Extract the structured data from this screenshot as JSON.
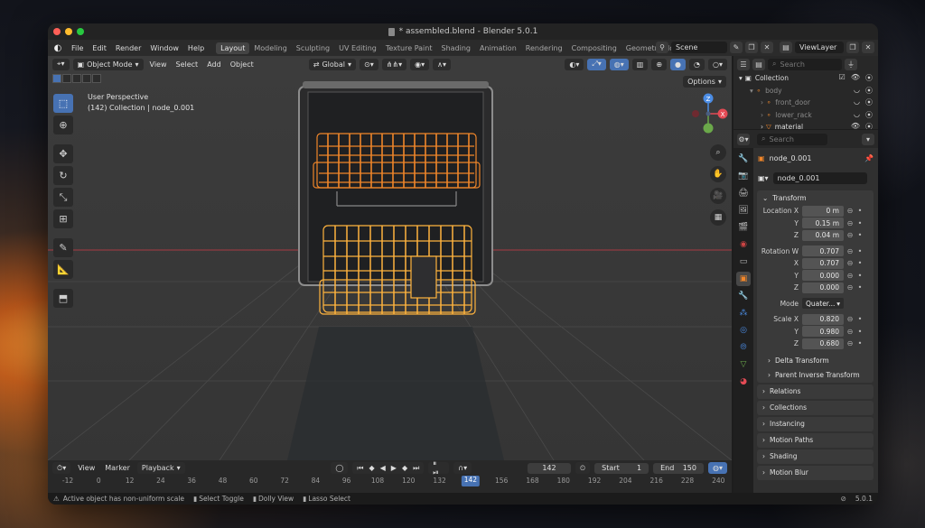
{
  "window": {
    "title": "* assembled.blend - Blender 5.0.1",
    "light_colors": [
      "#fe5f57",
      "#febc2e",
      "#28c840"
    ]
  },
  "topbar": {
    "menus": [
      "File",
      "Edit",
      "Render",
      "Window",
      "Help"
    ],
    "workspaces": [
      "Layout",
      "Modeling",
      "Sculpting",
      "UV Editing",
      "Texture Paint",
      "Shading",
      "Animation",
      "Rendering",
      "Compositing",
      "Geometry Nodes",
      "Sc"
    ],
    "active_workspace": "Layout",
    "scene_label": "Scene",
    "view_layer_label": "ViewLayer"
  },
  "viewport": {
    "mode": "Object Mode",
    "menus": [
      "View",
      "Select",
      "Add",
      "Object"
    ],
    "transform_orientation": "Global",
    "options_label": "Options",
    "info_line1": "User Perspective",
    "info_line2": "(142) Collection | node_0.001",
    "gizmo": {
      "x_label": "X",
      "y_label": "Y",
      "z_label": "Z",
      "x_color": "#e44b55",
      "y_color": "#6ba84a",
      "z_color": "#4b8ce4"
    },
    "selection_color": "#f0862a",
    "active_color": "#ffb33e"
  },
  "timeline": {
    "view_label": "View",
    "marker_label": "Marker",
    "playback_label": "Playback",
    "current_frame": "142",
    "start_label": "Start",
    "start_value": "1",
    "end_label": "End",
    "end_value": "150",
    "ruler_ticks": [
      "-12",
      "0",
      "12",
      "24",
      "36",
      "48",
      "60",
      "72",
      "84",
      "96",
      "108",
      "120",
      "132",
      "142",
      "156",
      "168",
      "180",
      "192",
      "204",
      "216",
      "228",
      "240"
    ]
  },
  "statusbar": {
    "warning": "Active object has non-uniform scale",
    "hint1": "Select Toggle",
    "hint2": "Dolly View",
    "hint3": "Lasso Select",
    "version": "5.0.1"
  },
  "outliner": {
    "search_placeholder": "Search",
    "rows": [
      {
        "label": "Collection",
        "indent": 0,
        "dim": false
      },
      {
        "label": "body",
        "indent": 1,
        "dim": true
      },
      {
        "label": "front_door",
        "indent": 2,
        "dim": true
      },
      {
        "label": "lower_rack",
        "indent": 2,
        "dim": true
      },
      {
        "label": "material",
        "indent": 2,
        "dim": false
      }
    ]
  },
  "properties": {
    "search_placeholder": "Search",
    "object_name": "node_0.001",
    "object_field": "node_0.001",
    "transform_header": "Transform",
    "location": {
      "label": "Location X",
      "x": "0 m",
      "y": "0.15 m",
      "z": "0.04 m"
    },
    "rotation": {
      "label": "Rotation W",
      "w": "0.707",
      "x": "0.707",
      "y": "0.000",
      "z": "0.000"
    },
    "mode_label": "Mode",
    "mode_value": "Quater...",
    "scale": {
      "label": "Scale X",
      "x": "0.820",
      "y": "0.980",
      "z": "0.680"
    },
    "axis_y": "Y",
    "axis_z": "Z",
    "axis_x": "X",
    "delta_transform": "Delta Transform",
    "parent_inverse": "Parent Inverse Transform",
    "panels": [
      "Relations",
      "Collections",
      "Instancing",
      "Motion Paths",
      "Shading",
      "Motion Blur"
    ]
  }
}
